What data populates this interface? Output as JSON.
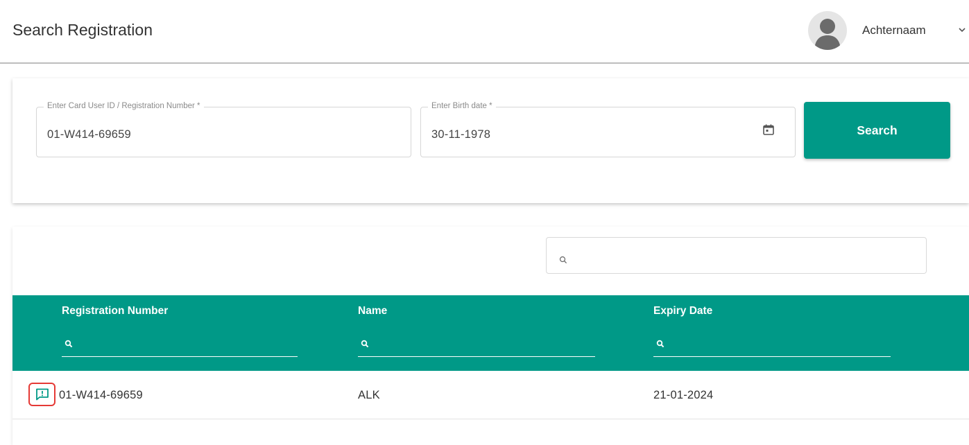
{
  "header": {
    "title": "Search Registration",
    "user_name": "Achternaam"
  },
  "search_form": {
    "id_field": {
      "label": "Enter Card User ID / Registration Number *",
      "value": "01-W414-69659"
    },
    "birth_field": {
      "label": "Enter Birth date *",
      "value": "30-11-1978"
    },
    "search_button": "Search"
  },
  "results": {
    "columns": [
      "Registration Number",
      "Name",
      "Expiry Date"
    ],
    "rows": [
      {
        "registration_number": "01-W414-69659",
        "name": "ALK",
        "expiry_date": "21-01-2024"
      }
    ]
  },
  "colors": {
    "primary": "#009987",
    "highlight": "#e53935"
  },
  "icons": [
    "user-avatar-icon",
    "chevron-down-icon",
    "calendar-icon",
    "search-icon",
    "feedback-icon"
  ]
}
